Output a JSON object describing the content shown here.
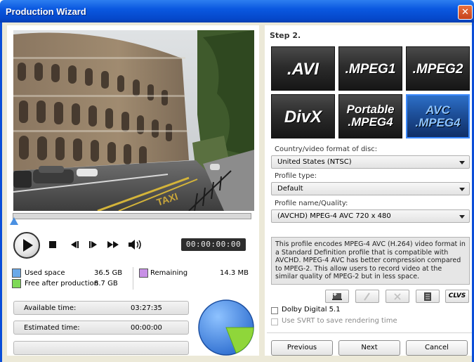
{
  "window": {
    "title": "Production Wizard",
    "close_glyph": "✕"
  },
  "player": {
    "timecode": "00:00:00:00",
    "icons": [
      "play-icon",
      "stop-icon",
      "prev-frame-icon",
      "next-frame-icon",
      "fast-forward-icon",
      "volume-icon"
    ]
  },
  "disk": {
    "used_label": "Used space",
    "used_value": "36.5 GB",
    "used_color": "#6aa9e8",
    "free_label": "Free after production",
    "free_value": "8.7 GB",
    "free_color": "#7ed957",
    "remaining_label": "Remaining",
    "remaining_value": "14.3 MB",
    "remaining_color": "#c890e6"
  },
  "times": {
    "available_label": "Available time:",
    "available_value": "03:27:35",
    "estimated_label": "Estimated time:",
    "estimated_value": "00:00:00"
  },
  "usage_pie": {
    "used_fraction": 0.81,
    "free_fraction": 0.19,
    "used_color": "#4f8fe6",
    "free_color": "#8fd63a"
  },
  "step": {
    "title": "Step 2."
  },
  "formats": [
    {
      "label": ".AVI",
      "selected": false
    },
    {
      "label": ".MPEG1",
      "selected": false
    },
    {
      "label": ".MPEG2",
      "selected": false
    },
    {
      "label": "DivX",
      "selected": false
    },
    {
      "label_line1": "Portable",
      "label_line2": ".MPEG4",
      "selected": false
    },
    {
      "label_line1": "AVC",
      "label_line2": ".MPEG4",
      "selected": true
    }
  ],
  "country": {
    "label": "Country/video format of disc:",
    "value": "United States (NTSC)"
  },
  "profile_type": {
    "label": "Profile type:",
    "value": "Default"
  },
  "profile_name": {
    "label": "Profile name/Quality:",
    "value": "(AVCHD) MPEG-4 AVC 720 x 480"
  },
  "description": "This profile encodes MPEG-4 AVC (H.264) video format in a Standard Definition profile that is compatible with AVCHD. MPEG-4 AVC has better compression compared to MPEG-2. This allow users to record video at the similar quality of MPEG-2 but in less space.",
  "toolbar": {
    "clvs_label": "CLVS",
    "icons": [
      "new-profile-icon",
      "edit-profile-icon",
      "delete-profile-icon",
      "profile-list-icon"
    ]
  },
  "options": {
    "dolby": {
      "label": "Dolby Digital 5.1",
      "checked": false
    },
    "svrt": {
      "label": "Use SVRT to save rendering time",
      "checked": false,
      "enabled": false
    }
  },
  "buttons": {
    "previous": "Previous",
    "next": "Next",
    "cancel": "Cancel"
  }
}
